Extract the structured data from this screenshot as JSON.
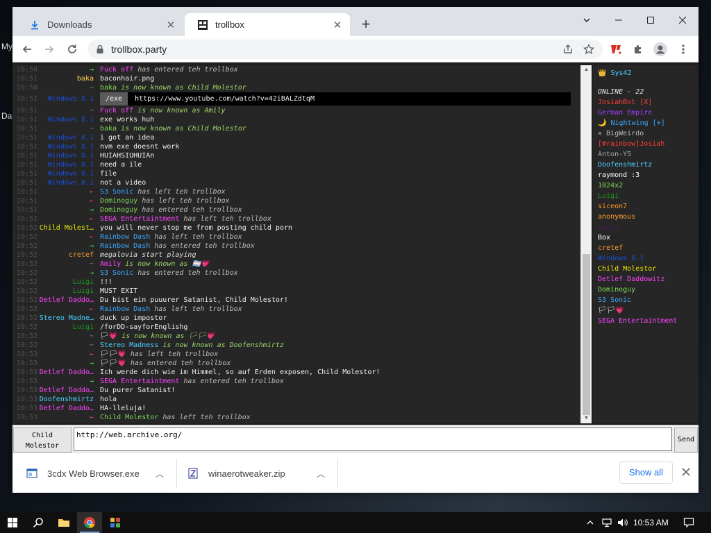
{
  "desktop": {
    "edge_text_1": "My",
    "edge_text_2": "Da"
  },
  "browser": {
    "tabs": [
      {
        "label": "Downloads",
        "active": false,
        "icon": "download-icon"
      },
      {
        "label": "trollbox",
        "active": true,
        "icon": "trollbox-favicon"
      }
    ],
    "url": "trollbox.party"
  },
  "chat": {
    "lines": [
      {
        "time": "10:50",
        "nick": "→",
        "nick_color": "#55dd55",
        "user": "Fuck off",
        "user_color": "#ff44ff",
        "text": "has entered teh trollbox",
        "kind": "event"
      },
      {
        "time": "10:51",
        "nick": "baka",
        "nick_color": "#ffd24a",
        "text": "baconhair.png",
        "kind": "msg"
      },
      {
        "time": "10:50",
        "nick": "~",
        "nick_color": "#888888",
        "user": "baka",
        "user_color": "#7ed957",
        "text": "is now known as Child Molestor",
        "kind": "event"
      },
      {
        "time": "10:51",
        "nick": "Windows 8.1",
        "nick_color": "#1a4cd6",
        "button": "/exe",
        "text": "https://www.youtube.com/watch?v=42iBALZdtqM",
        "kind": "yt"
      },
      {
        "time": "10:51",
        "nick": "~",
        "nick_color": "#888888",
        "user": "Fuck off",
        "user_color": "#ff44ff",
        "text": "is now known as Amily",
        "kind": "event"
      },
      {
        "time": "10:51",
        "nick": "Windows 8.1",
        "nick_color": "#1a4cd6",
        "text": "exe works huh",
        "kind": "msg"
      },
      {
        "time": "10:51",
        "nick": "~",
        "nick_color": "#888888",
        "user": "baka",
        "user_color": "#7ed957",
        "text": "is now known as Child Molestor",
        "kind": "event"
      },
      {
        "time": "10:51",
        "nick": "Windows 8.1",
        "nick_color": "#1a4cd6",
        "text": "i got an idea",
        "kind": "msg"
      },
      {
        "time": "10:51",
        "nick": "Windows 8.1",
        "nick_color": "#1a4cd6",
        "text": "nvm exe doesnt work",
        "kind": "msg"
      },
      {
        "time": "10:51",
        "nick": "Windows 8.1",
        "nick_color": "#1a4cd6",
        "text": "HUIAHSIUHUIAn",
        "kind": "msg"
      },
      {
        "time": "10:51",
        "nick": "Windows 8.1",
        "nick_color": "#1a4cd6",
        "text": "need a ile",
        "kind": "msg"
      },
      {
        "time": "10:51",
        "nick": "Windows 8.1",
        "nick_color": "#1a4cd6",
        "text": "file",
        "kind": "msg"
      },
      {
        "time": "10:51",
        "nick": "Windows 8.1",
        "nick_color": "#1a4cd6",
        "text": "not a video",
        "kind": "msg"
      },
      {
        "time": "10:51",
        "nick": "←",
        "nick_color": "#ee4444",
        "user": "S3 Sonic",
        "user_color": "#3ba8ff",
        "text": "has left teh trollbox",
        "kind": "event"
      },
      {
        "time": "10:51",
        "nick": "←",
        "nick_color": "#ee4444",
        "user": "Dominoguy",
        "user_color": "#7ed957",
        "text": "has left teh trollbox",
        "kind": "event"
      },
      {
        "time": "10:51",
        "nick": "→",
        "nick_color": "#55dd55",
        "user": "Dominoguy",
        "user_color": "#7ed957",
        "text": "has entered teh trollbox",
        "kind": "event"
      },
      {
        "time": "10:51",
        "nick": "←",
        "nick_color": "#ee4444",
        "user": "SEGA Entertaintment",
        "user_color": "#ff44ff",
        "text": "has left teh trollbox",
        "kind": "event"
      },
      {
        "time": "10:52",
        "nick": "Child Molest…",
        "nick_color": "#e6e600",
        "text": "you will never stop me from posting child porn",
        "kind": "msg"
      },
      {
        "time": "10:52",
        "nick": "←",
        "nick_color": "#ee4444",
        "user": "Rainbow Dash",
        "user_color": "#3ba8ff",
        "text": "has left teh trollbox",
        "kind": "event"
      },
      {
        "time": "10:52",
        "nick": "→",
        "nick_color": "#55dd55",
        "user": "Rainbow Dash",
        "user_color": "#3ba8ff",
        "text": "has entered teh trollbox",
        "kind": "event"
      },
      {
        "time": "10:52",
        "nick": "cretef",
        "nick_color": "#ff9a2e",
        "text": "megalovia start playing",
        "kind": "italic"
      },
      {
        "time": "10:52",
        "nick": "~",
        "nick_color": "#888888",
        "user": "Amily",
        "user_color": "#ff44ff",
        "text": "is now known as 🏳‍⚧💗",
        "kind": "event"
      },
      {
        "time": "10:52",
        "nick": "→",
        "nick_color": "#55dd55",
        "user": "S3 Sonic",
        "user_color": "#3ba8ff",
        "text": "has entered teh trollbox",
        "kind": "event"
      },
      {
        "time": "10:52",
        "nick": "Luigi",
        "nick_color": "#1e9a1e",
        "text": "!!!",
        "kind": "msg"
      },
      {
        "time": "10:52",
        "nick": "Luigi",
        "nick_color": "#1e9a1e",
        "text": "MUST EXIT",
        "kind": "msg"
      },
      {
        "time": "10:52",
        "nick": "Detlef Daddo…",
        "nick_color": "#ff44ff",
        "text": "Du bist ein puuurer Satanist, Child Molestor!",
        "kind": "msg"
      },
      {
        "time": "10:52",
        "nick": "←",
        "nick_color": "#ee4444",
        "user": "Rainbow Dash",
        "user_color": "#3ba8ff",
        "text": "has left teh trollbox",
        "kind": "event"
      },
      {
        "time": "10:52",
        "nick": "Stereo Madne…",
        "nick_color": "#4ad0ff",
        "text": "duck up impostor",
        "kind": "msg"
      },
      {
        "time": "10:52",
        "nick": "Luigi",
        "nick_color": "#1e9a1e",
        "text": "/forDD-sayforEnglishg",
        "kind": "msg"
      },
      {
        "time": "10:52",
        "nick": "~",
        "nick_color": "#888888",
        "user": "🏳💗",
        "user_color": "#ffffff",
        "text": "is now known as 🏳🏳💗",
        "kind": "event"
      },
      {
        "time": "10:52",
        "nick": "~",
        "nick_color": "#888888",
        "user": "Stereo Madness",
        "user_color": "#4ad0ff",
        "text": "is now known as Doofenshmirtz",
        "kind": "event"
      },
      {
        "time": "10:53",
        "nick": "←",
        "nick_color": "#ee4444",
        "user": "🏳🏳💗",
        "user_color": "#ffffff",
        "text": "has left teh trollbox",
        "kind": "event"
      },
      {
        "time": "10:53",
        "nick": "→",
        "nick_color": "#55dd55",
        "user": "🏳🏳💗",
        "user_color": "#ffffff",
        "text": "has entered teh trollbox",
        "kind": "event"
      },
      {
        "time": "10:53",
        "nick": "Detlef Daddo…",
        "nick_color": "#ff44ff",
        "text": "Ich werde dich wie im Himmel, so auf Erden exposen, Child Molestor!",
        "kind": "msg"
      },
      {
        "time": "10:53",
        "nick": "→",
        "nick_color": "#55dd55",
        "user": "SEGA Entertaintment",
        "user_color": "#ff44ff",
        "text": "has entered teh trollbox",
        "kind": "event"
      },
      {
        "time": "10:53",
        "nick": "Detlef Daddo…",
        "nick_color": "#ff44ff",
        "text": "Du purer Satanist!",
        "kind": "msg"
      },
      {
        "time": "10:53",
        "nick": "Doofenshmirtz",
        "nick_color": "#4ad0ff",
        "text": "hola",
        "kind": "msg"
      },
      {
        "time": "10:53",
        "nick": "Detlef Daddo…",
        "nick_color": "#ff44ff",
        "text": "HA-lleluja!",
        "kind": "msg"
      },
      {
        "time": "10:53",
        "nick": "←",
        "nick_color": "#ee4444",
        "user": "Child Molestor",
        "user_color": "#7ed957",
        "text": "has left teh trollbox",
        "kind": "event"
      }
    ]
  },
  "userlist": {
    "me": "👑 Sys42",
    "online_label": "ONLINE - 22",
    "users": [
      {
        "name": "JosiahBot [X]",
        "color": "#ff3b3b"
      },
      {
        "name": "German Empire",
        "color": "#a33cff"
      },
      {
        "name": "🌙 Nightwing [+]",
        "color": "#3ba8ff"
      },
      {
        "name": "✕ BigWeirdo",
        "color": "#bbbbbb"
      },
      {
        "name": "[#rainbow]Josiah",
        "color": "#ff3b3b"
      },
      {
        "name": "Anton-Y5",
        "color": "#a8a8a8"
      },
      {
        "name": "Doofenshmirtz",
        "color": "#4ad0ff"
      },
      {
        "name": "raymond :3",
        "color": "#ffffff"
      },
      {
        "name": "1024x2",
        "color": "#7ed957"
      },
      {
        "name": "Luigi",
        "color": "#1e9a1e"
      },
      {
        "name": "siceon7",
        "color": "#ff9a2e"
      },
      {
        "name": "anonymous",
        "color": "#ff9a2e"
      },
      {
        "name": "Lapis",
        "color": "#4a1a5a"
      },
      {
        "name": "Box",
        "color": "#ffffff"
      },
      {
        "name": "cretef",
        "color": "#ff9a2e"
      },
      {
        "name": "Windows 8.1",
        "color": "#1a4cd6"
      },
      {
        "name": "Child Molestor",
        "color": "#e6e600"
      },
      {
        "name": "Detlef Daddowitz",
        "color": "#ff44ff"
      },
      {
        "name": "Dominoguy",
        "color": "#7ed957"
      },
      {
        "name": "S3 Sonic",
        "color": "#3ba8ff"
      },
      {
        "name": "🏳🏳💗",
        "color": "#ffffff"
      },
      {
        "name": "SEGA Entertaintment",
        "color": "#ff44ff"
      }
    ]
  },
  "input": {
    "nick_line1": "Child",
    "nick_line2": "Molestor",
    "value": "http://web.archive.org/",
    "send_label": "Send"
  },
  "downloads": {
    "items": [
      {
        "name": "3cdx Web Browser.exe",
        "icon": "exe-file-icon"
      },
      {
        "name": "winaerotweaker.zip",
        "icon": "zip-file-icon"
      }
    ],
    "show_all": "Show all"
  },
  "taskbar": {
    "clock": "10:53 AM"
  },
  "colors": {
    "chat_bg": "#262626",
    "timestamp": "#4f4f4f",
    "link_blue": "#1a73e8"
  }
}
